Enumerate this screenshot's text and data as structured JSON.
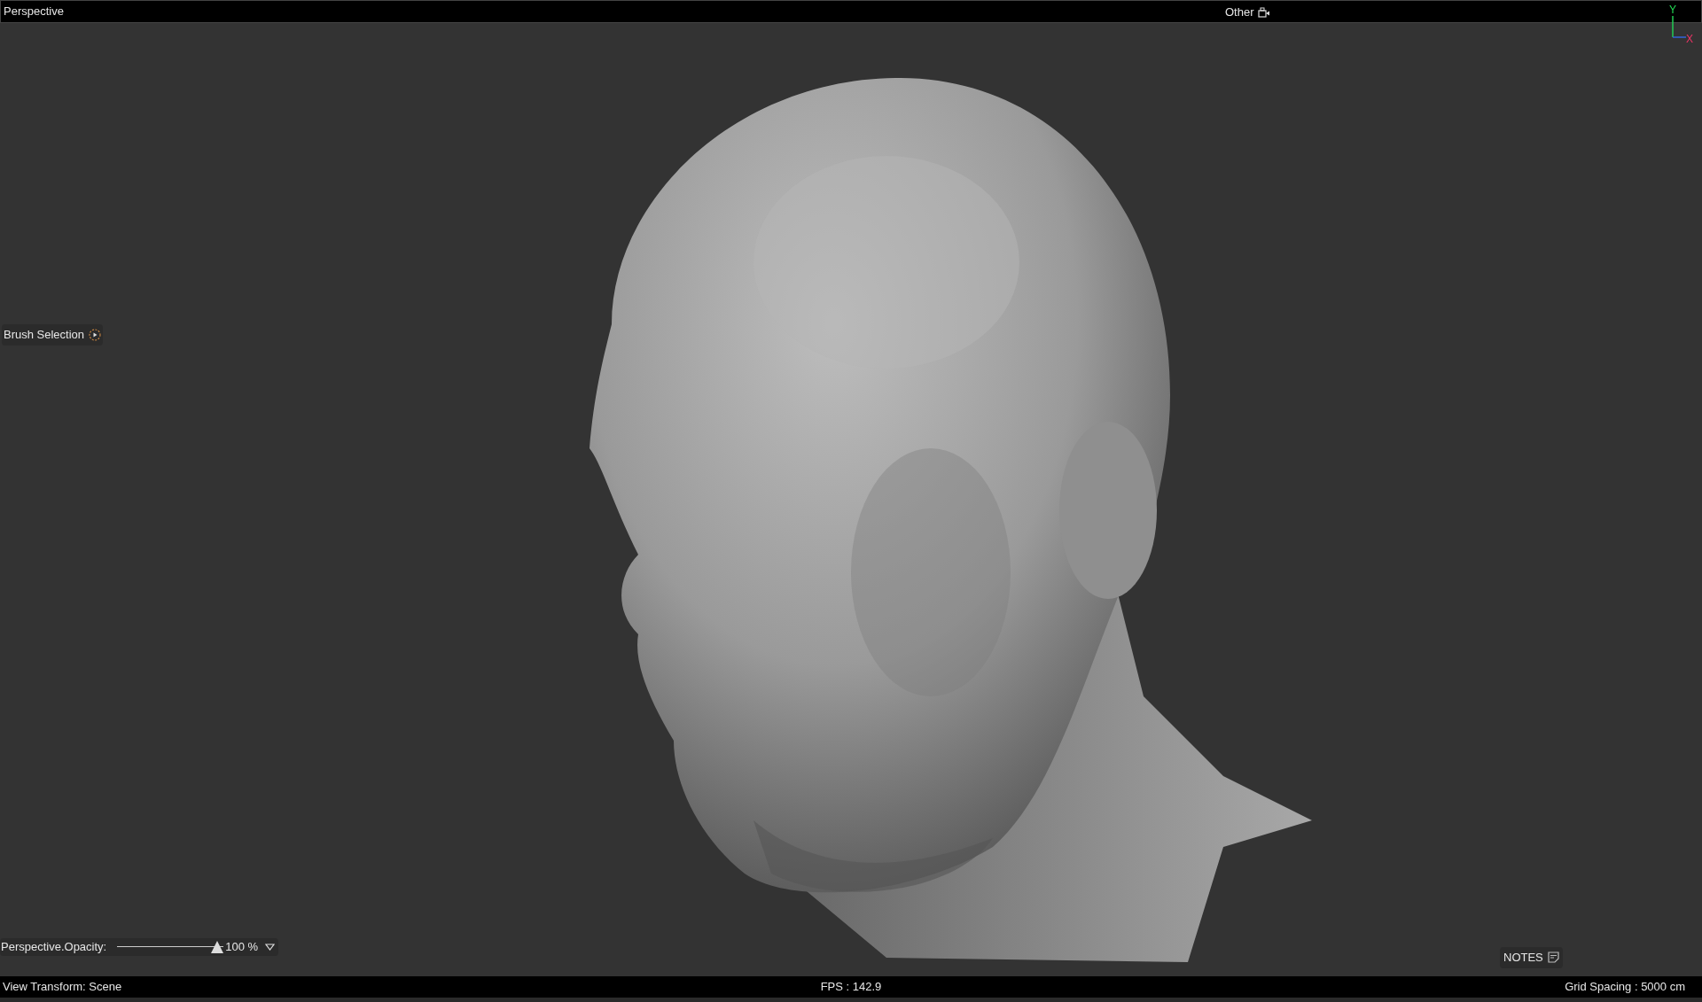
{
  "top_bar": {
    "view_name": "Perspective",
    "camera": "Other"
  },
  "axes": {
    "y_label": "Y",
    "x_label": "X"
  },
  "viewport": {
    "brush_selection": {
      "label": "Brush Selection"
    },
    "opacity": {
      "label": "Perspective.Opacity:",
      "level": 1,
      "reading": "100 %"
    },
    "notes": {
      "label": "NOTES"
    }
  },
  "status_bar": {
    "view_transform": "View Transform: Scene",
    "fps": "FPS : 142.9",
    "grid_spacing": "Grid Spacing : 5000 cm"
  }
}
